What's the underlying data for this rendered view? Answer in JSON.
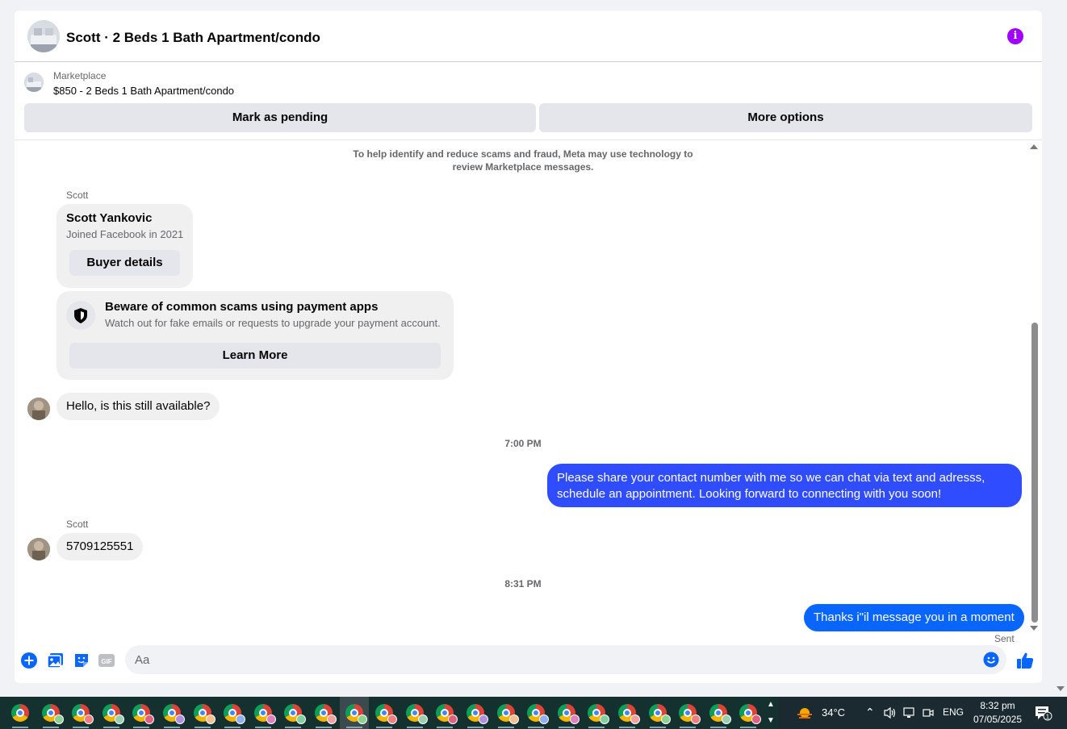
{
  "header": {
    "title": "Scott · 2 Beds 1 Bath Apartment/condo",
    "info_icon": "info-icon",
    "info_color": "#a100ff"
  },
  "listing": {
    "category": "Marketplace",
    "name": "$850 - 2 Beds 1 Bath Apartment/condo",
    "mark_pending": "Mark as pending",
    "more_options": "More options"
  },
  "messages": {
    "notice": "To help identify and reduce scams and fraud, Meta may use technology to review Marketplace messages.",
    "sender_1": "Scott",
    "profile": {
      "name": "Scott Yankovic",
      "joined": "Joined Facebook in 2021",
      "button": "Buyer details"
    },
    "scam_warning": {
      "icon": "shield-icon",
      "title": "Beware of common scams using payment apps",
      "subtitle": "Watch out for fake emails or requests to upgrade your payment account.",
      "button": "Learn More"
    },
    "incoming_1": "Hello, is this still available?",
    "time_1": "7:00 PM",
    "outgoing_1": "Please share your contact number with me so we can chat via text and adresss, schedule an appointment. Looking forward to connecting with you soon!",
    "sender_2": "Scott",
    "incoming_2": "5709125551",
    "time_2": "8:31 PM",
    "outgoing_2": "Thanks i\"il message you in a moment",
    "status": "Sent",
    "outgoing_color": "#0866ff"
  },
  "composer": {
    "placeholder": "Aa",
    "icons": [
      "plus-icon",
      "image-icon",
      "sticker-icon",
      "gif-icon",
      "emoji-icon",
      "like-icon"
    ],
    "gif_label": "GIF",
    "accent_color": "#0866ff"
  },
  "taskbar": {
    "app_count": 25,
    "temperature": "34°C",
    "language": "ENG",
    "time": "8:32 pm",
    "date": "07/05/2025",
    "notification_count": "1"
  }
}
